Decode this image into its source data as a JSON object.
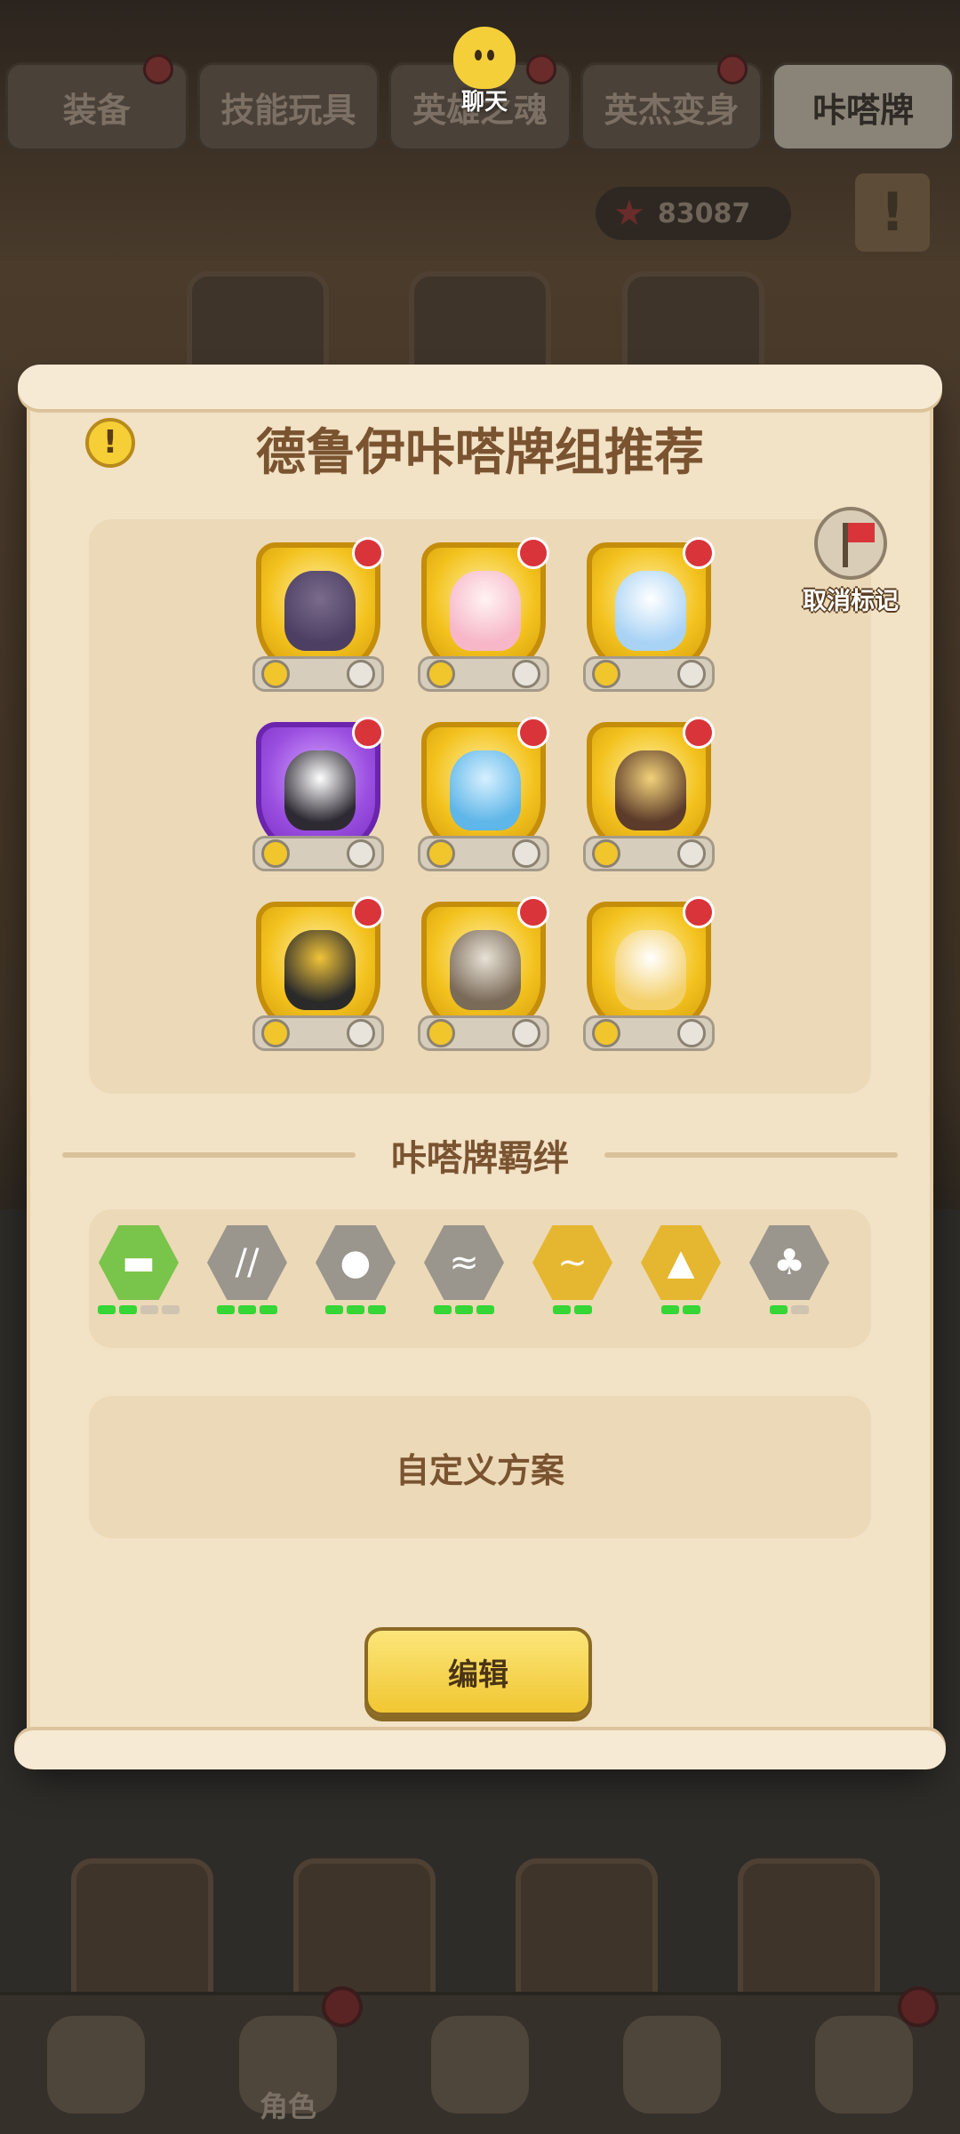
{
  "tabs": [
    {
      "label": "装备",
      "badge": true,
      "active": false
    },
    {
      "label": "技能玩具",
      "badge": false,
      "active": false
    },
    {
      "label": "英雄之魂",
      "badge": true,
      "active": false
    },
    {
      "label": "英杰变身",
      "badge": true,
      "active": false
    },
    {
      "label": "咔嗒牌",
      "badge": false,
      "active": true
    }
  ],
  "chat": {
    "label": "聊天"
  },
  "currency": {
    "amount": "83087",
    "icon": "starfish-icon"
  },
  "modal": {
    "title": "德鲁伊咔嗒牌组推荐",
    "unmark_label": "取消标记",
    "cards": [
      {
        "rarity": "gold",
        "flagged": true,
        "colors": [
          "#4d3f63",
          "#7a6b8c"
        ]
      },
      {
        "rarity": "gold",
        "flagged": true,
        "colors": [
          "#f7b7c9",
          "#fff3f3"
        ]
      },
      {
        "rarity": "gold",
        "flagged": true,
        "colors": [
          "#a9d3f5",
          "#ffffff"
        ]
      },
      {
        "rarity": "purple",
        "flagged": true,
        "colors": [
          "#2e2a33",
          "#ffffff"
        ]
      },
      {
        "rarity": "gold",
        "flagged": true,
        "colors": [
          "#5fb6e8",
          "#d6f0ff"
        ]
      },
      {
        "rarity": "gold",
        "flagged": true,
        "colors": [
          "#5c3b2a",
          "#f2d27a"
        ]
      },
      {
        "rarity": "gold",
        "flagged": true,
        "colors": [
          "#2a2a2a",
          "#f0c33a"
        ]
      },
      {
        "rarity": "gold",
        "flagged": true,
        "colors": [
          "#7a6a58",
          "#e8e2d6"
        ]
      },
      {
        "rarity": "gold",
        "flagged": true,
        "colors": [
          "#f4d06a",
          "#ffffff"
        ]
      }
    ],
    "bond_title": "咔嗒牌羁绊",
    "bonds": [
      {
        "icon": "grass-icon",
        "color": "#79c44a",
        "bars": [
          true,
          true,
          false,
          false
        ]
      },
      {
        "icon": "claw-icon",
        "color": "#9a958d",
        "bars": [
          true,
          true,
          true
        ]
      },
      {
        "icon": "fluff-icon",
        "color": "#9a958d",
        "bars": [
          true,
          true,
          true
        ]
      },
      {
        "icon": "wing-icon",
        "color": "#9a958d",
        "bars": [
          true,
          true,
          true
        ]
      },
      {
        "icon": "water-icon",
        "color": "#e5b730",
        "bars": [
          true,
          true
        ]
      },
      {
        "icon": "tree-icon",
        "color": "#e5b730",
        "bars": [
          true,
          true
        ]
      },
      {
        "icon": "palm-icon",
        "color": "#9a958d",
        "bars": [
          true,
          false
        ]
      }
    ],
    "custom_label": "自定义方案",
    "edit_label": "编辑"
  },
  "nav": {
    "items": [
      {
        "name": "hero",
        "label": "",
        "badge": false
      },
      {
        "name": "character",
        "label": "角色",
        "badge": true
      },
      {
        "name": "weapon",
        "label": "",
        "badge": false
      },
      {
        "name": "pet",
        "label": "",
        "badge": false
      },
      {
        "name": "shop",
        "label": "",
        "badge": true
      }
    ]
  }
}
